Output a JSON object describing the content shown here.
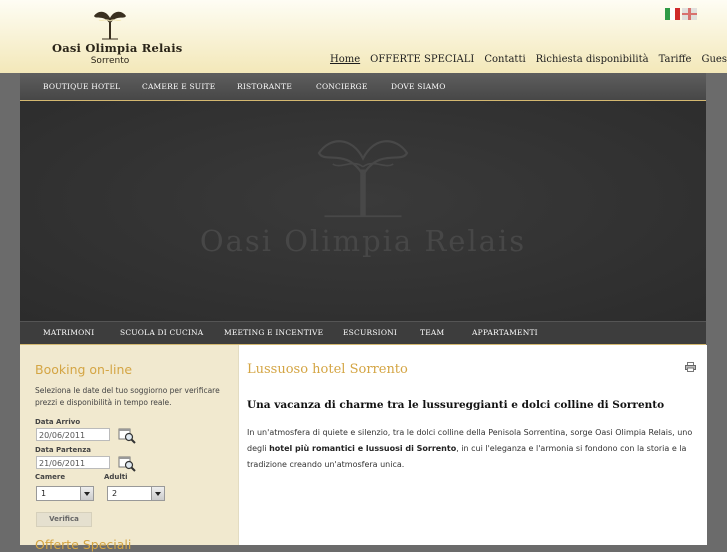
{
  "brand": {
    "name": "Oasi Olimpia Relais",
    "city": "Sorrento",
    "logo_icon": "tree-logo-icon"
  },
  "languages": [
    {
      "name": "italian-flag-icon"
    },
    {
      "name": "english-flag-icon"
    }
  ],
  "top_nav": [
    "Home",
    "OFFERTE SPECIALI",
    "Contatti",
    "Richiesta disponibilità",
    "Tariffe",
    "Guestbook"
  ],
  "main_menu": [
    "BOUTIQUE HOTEL",
    "CAMERE E SUITE",
    "RISTORANTE",
    "CONCIERGE",
    "DOVE SIAMO"
  ],
  "hero": {
    "watermark": "Oasi Olimpia Relais"
  },
  "secondary_menu": [
    "MATRIMONI",
    "SCUOLA DI CUCINA",
    "MEETING E INCENTIVE",
    "ESCURSIONI",
    "TEAM",
    "APPARTAMENTI"
  ],
  "booking": {
    "title": "Booking on-line",
    "description": "Seleziona le date del tuo soggiorno per verificare prezzi e disponibilità in tempo reale.",
    "arrival_label": "Data Arrivo",
    "arrival_value": "20/06/2011",
    "departure_label": "Data Partenza",
    "departure_value": "21/06/2011",
    "rooms_label": "Camere",
    "rooms_value": "1",
    "adults_label": "Adulti",
    "adults_value": "2",
    "submit_label": "Verifica",
    "next_title": "Offerte Speciali"
  },
  "content": {
    "title": "Lussuoso hotel Sorrento",
    "subtitle": "Una vacanza di charme tra le lussureggianti e dolci colline di Sorrento",
    "body_part1": "In un'atmosfera di quiete e silenzio, tra le dolci colline della Penisola Sorrentina, sorge Oasi Olimpia Relais, uno degli ",
    "body_bold": "hotel più romantici e lussuosi di Sorrento",
    "body_part2": ", in cui l'eleganza e l'armonia si fondono con la storia e la tradizione creando un'atmosfera unica."
  },
  "colors": {
    "accent": "#d4a544",
    "header_bg": "#f3e8b9",
    "dark_bg": "#2e2e2e",
    "sidebar_bg": "#f1e9cf"
  }
}
